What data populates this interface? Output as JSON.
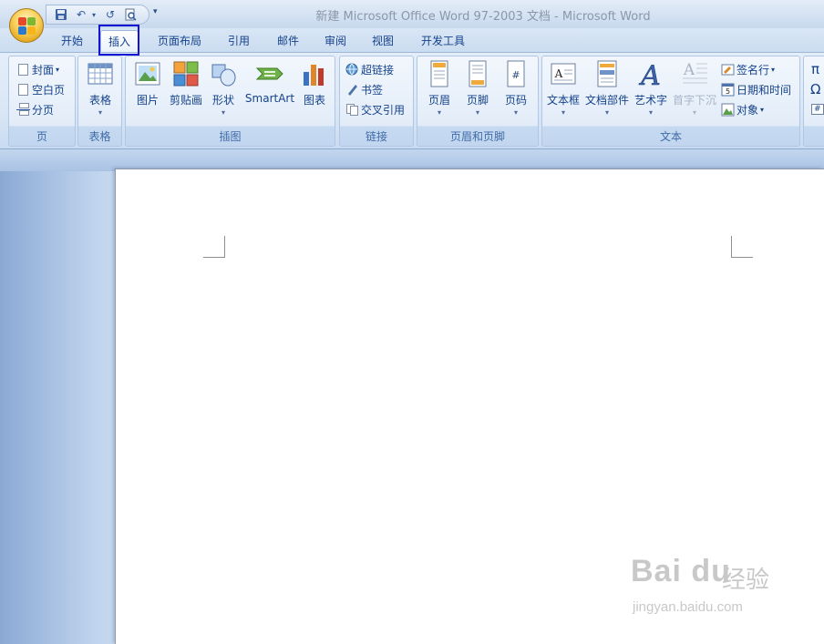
{
  "window": {
    "title": "新建 Microsoft Office Word 97-2003 文档 - Microsoft Word"
  },
  "quick_access": {
    "items": [
      "save-icon",
      "undo-icon",
      "redo-icon",
      "print-preview-icon",
      "customize-icon"
    ],
    "undo_glyph": "↶",
    "redo_glyph": "↺",
    "more_glyph": "▾"
  },
  "tabs": [
    {
      "label": "开始"
    },
    {
      "label": "插入",
      "active": true
    },
    {
      "label": "页面布局"
    },
    {
      "label": "引用"
    },
    {
      "label": "邮件"
    },
    {
      "label": "审阅"
    },
    {
      "label": "视图"
    },
    {
      "label": "开发工具"
    }
  ],
  "ribbon": {
    "groups": {
      "pages": {
        "label": "页",
        "cover": "封面",
        "blank": "空白页",
        "break": "分页"
      },
      "tables": {
        "label": "表格",
        "table": "表格"
      },
      "illustrations": {
        "label": "插图",
        "picture": "图片",
        "clipart": "剪贴画",
        "shapes": "形状",
        "smartart": "SmartArt",
        "chart": "图表"
      },
      "links": {
        "label": "链接",
        "hyperlink": "超链接",
        "bookmark": "书签",
        "crossref": "交叉引用"
      },
      "header_footer": {
        "label": "页眉和页脚",
        "header": "页眉",
        "footer": "页脚",
        "page_number": "页码"
      },
      "text": {
        "label": "文本",
        "textbox": "文本框",
        "quickparts": "文档部件",
        "wordart": "艺术字",
        "dropcap": "首字下沉",
        "signature": "签名行",
        "datetime": "日期和时间",
        "object": "对象"
      },
      "symbols": {
        "pi_glyph": "π",
        "omega_glyph": "Ω",
        "hash_glyph": "#"
      }
    },
    "dropdown_glyph": "▾"
  },
  "watermark": {
    "brand": "Bai du",
    "cn": "经验",
    "url": "jingyan.baidu.com"
  },
  "colors": {
    "accent_highlight": "#1414d2",
    "ribbon_text": "#15428b",
    "page": "#ffffff"
  }
}
